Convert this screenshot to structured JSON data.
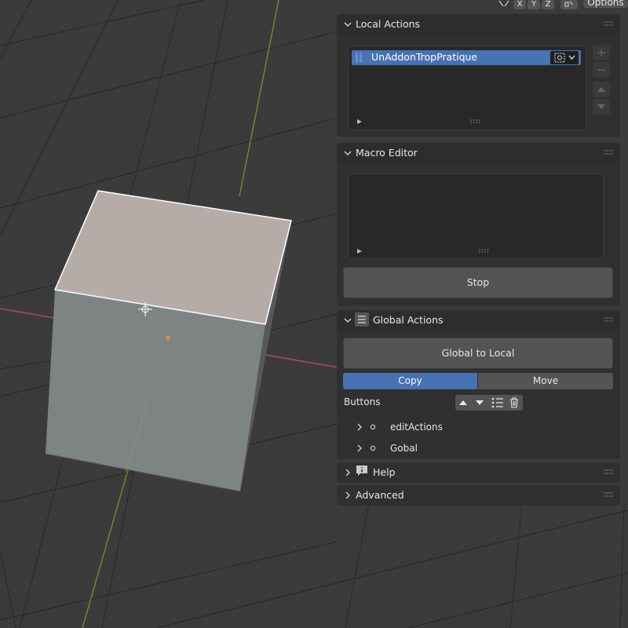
{
  "header": {
    "axis_x": "X",
    "axis_y": "Y",
    "axis_z": "Z",
    "options_label": "Options"
  },
  "local_actions": {
    "title": "Local Actions",
    "selected_item": "UnAddonTropPratique"
  },
  "macro_editor": {
    "title": "Macro Editor",
    "stop_label": "Stop"
  },
  "global_actions": {
    "title": "Global Actions",
    "global_to_local_label": "Global to Local",
    "copy_label": "Copy",
    "move_label": "Move",
    "buttons_label": "Buttons",
    "tree_items": [
      "editActions",
      "Gobal"
    ]
  },
  "help": {
    "title": "Help"
  },
  "advanced": {
    "title": "Advanced"
  },
  "colors": {
    "accent": "#4772b3",
    "x_axis": "#b34b54",
    "y_axis": "#6a8a2a",
    "panel_bg": "#303030",
    "viewport_bg": "#3a3a3a"
  }
}
